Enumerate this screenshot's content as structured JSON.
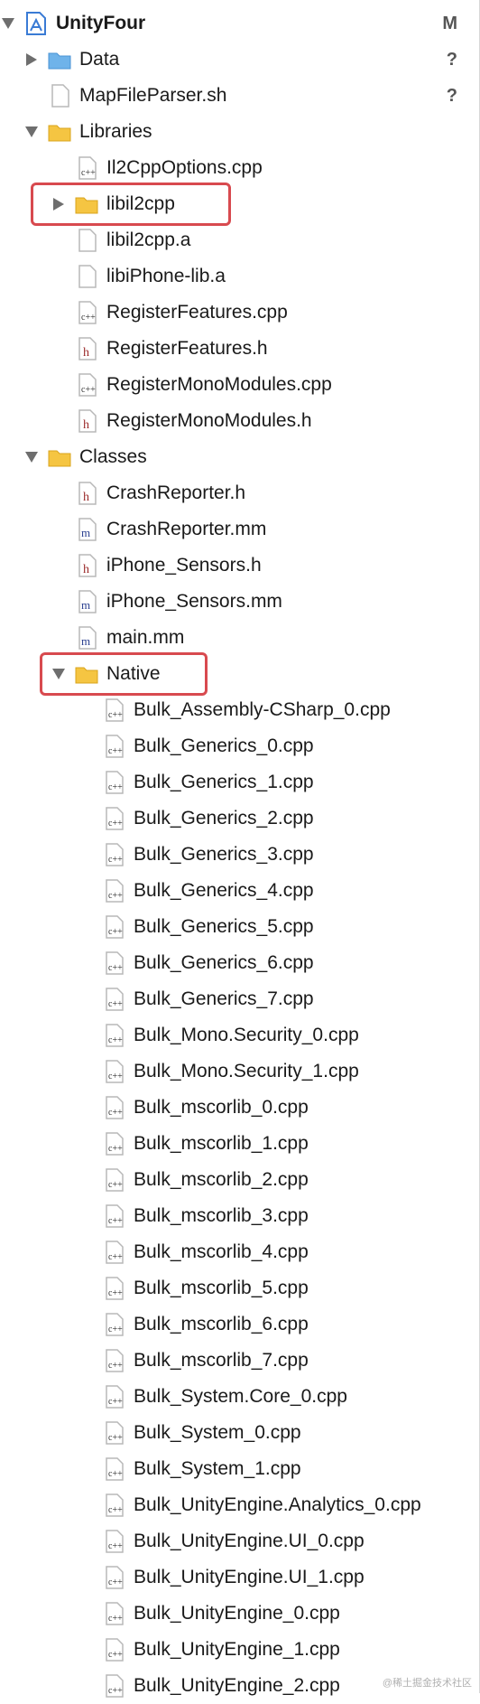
{
  "project": {
    "name": "UnityFour",
    "status": "M"
  },
  "items": [
    {
      "label": "Data",
      "status": "?"
    },
    {
      "label": "MapFileParser.sh",
      "status": "?"
    },
    {
      "label": "Libraries"
    },
    {
      "label": "Il2CppOptions.cpp"
    },
    {
      "label": "libil2cpp"
    },
    {
      "label": "libil2cpp.a"
    },
    {
      "label": "libiPhone-lib.a"
    },
    {
      "label": "RegisterFeatures.cpp"
    },
    {
      "label": "RegisterFeatures.h"
    },
    {
      "label": "RegisterMonoModules.cpp"
    },
    {
      "label": "RegisterMonoModules.h"
    },
    {
      "label": "Classes"
    },
    {
      "label": "CrashReporter.h"
    },
    {
      "label": "CrashReporter.mm"
    },
    {
      "label": "iPhone_Sensors.h"
    },
    {
      "label": "iPhone_Sensors.mm"
    },
    {
      "label": "main.mm"
    },
    {
      "label": "Native"
    },
    {
      "label": "Bulk_Assembly-CSharp_0.cpp"
    },
    {
      "label": "Bulk_Generics_0.cpp"
    },
    {
      "label": "Bulk_Generics_1.cpp"
    },
    {
      "label": "Bulk_Generics_2.cpp"
    },
    {
      "label": "Bulk_Generics_3.cpp"
    },
    {
      "label": "Bulk_Generics_4.cpp"
    },
    {
      "label": "Bulk_Generics_5.cpp"
    },
    {
      "label": "Bulk_Generics_6.cpp"
    },
    {
      "label": "Bulk_Generics_7.cpp"
    },
    {
      "label": "Bulk_Mono.Security_0.cpp"
    },
    {
      "label": "Bulk_Mono.Security_1.cpp"
    },
    {
      "label": "Bulk_mscorlib_0.cpp"
    },
    {
      "label": "Bulk_mscorlib_1.cpp"
    },
    {
      "label": "Bulk_mscorlib_2.cpp"
    },
    {
      "label": "Bulk_mscorlib_3.cpp"
    },
    {
      "label": "Bulk_mscorlib_4.cpp"
    },
    {
      "label": "Bulk_mscorlib_5.cpp"
    },
    {
      "label": "Bulk_mscorlib_6.cpp"
    },
    {
      "label": "Bulk_mscorlib_7.cpp"
    },
    {
      "label": "Bulk_System.Core_0.cpp"
    },
    {
      "label": "Bulk_System_0.cpp"
    },
    {
      "label": "Bulk_System_1.cpp"
    },
    {
      "label": "Bulk_UnityEngine.Analytics_0.cpp"
    },
    {
      "label": "Bulk_UnityEngine.UI_0.cpp"
    },
    {
      "label": "Bulk_UnityEngine.UI_1.cpp"
    },
    {
      "label": "Bulk_UnityEngine_0.cpp"
    },
    {
      "label": "Bulk_UnityEngine_1.cpp"
    },
    {
      "label": "Bulk_UnityEngine_2.cpp"
    }
  ],
  "watermark": "@稀土掘金技术社区",
  "colors": {
    "highlight": "#d84a4f",
    "folder": "#f5c542",
    "blue_folder": "#6fb3ea"
  }
}
